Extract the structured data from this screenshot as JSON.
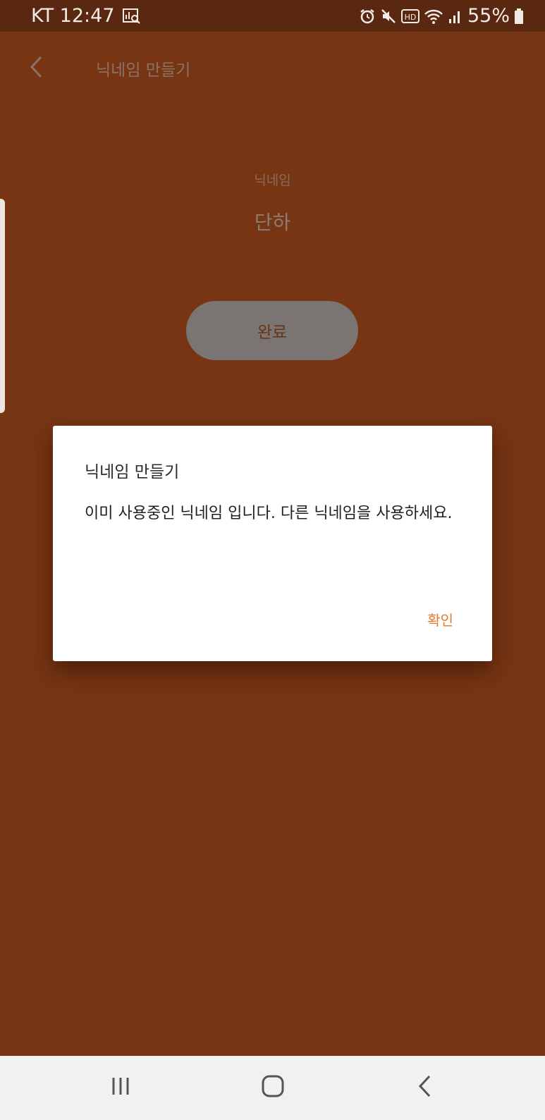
{
  "status_bar": {
    "carrier_time": "KT 12:47",
    "battery": "55%",
    "icons": [
      "search-chart-icon",
      "alarm-icon",
      "mute-icon",
      "hd-icon",
      "wifi-icon",
      "signal-icon",
      "battery-icon"
    ]
  },
  "appbar": {
    "title": "닉네임 만들기",
    "back_icon": "back-arrow-icon"
  },
  "form": {
    "label": "닉네임",
    "value": "단하",
    "done_label": "완료"
  },
  "dialog": {
    "title": "닉네임 만들기",
    "message": "이미 사용중인 닉네임 입니다. 다른 닉네임을 사용하세요.",
    "confirm_label": "확인"
  },
  "navbar": {
    "icons": [
      "recent-apps-icon",
      "home-icon",
      "back-icon"
    ]
  },
  "colors": {
    "overlay_background": "#773513",
    "status_bar": "#5a2810",
    "accent": "#e5772c"
  }
}
